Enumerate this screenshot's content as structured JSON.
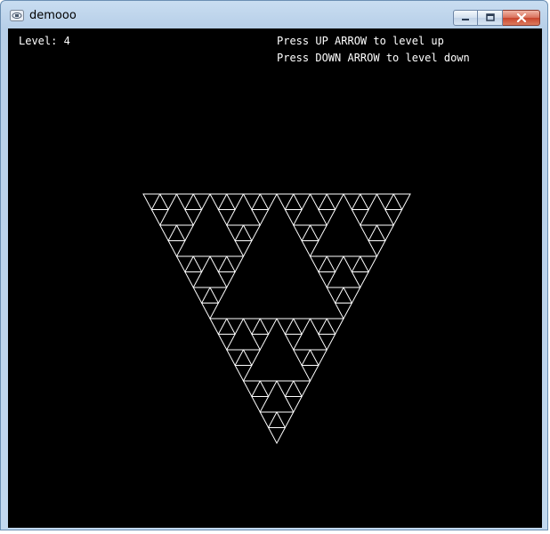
{
  "window": {
    "title": "demooo",
    "app_icon": "console-app-icon",
    "controls": [
      "minimize-icon",
      "maximize-icon",
      "close-icon"
    ]
  },
  "hud": {
    "level_label": "Level: 4",
    "help_up": "Press UP ARROW to level up",
    "help_down": "Press DOWN ARROW to level down"
  },
  "scene": {
    "background": "#000000",
    "stroke_color": "#ffffff",
    "fractal": "sierpinski-triangle-inverted",
    "level": 4
  }
}
